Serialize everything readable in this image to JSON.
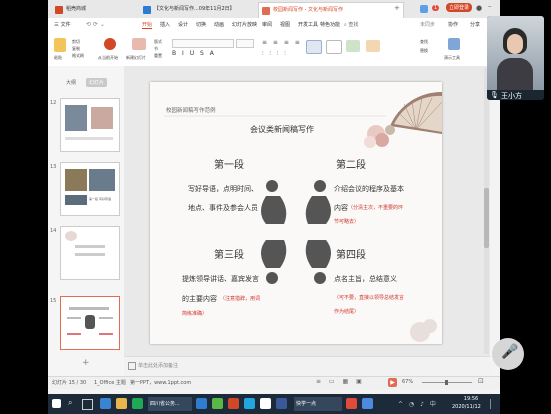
{
  "tabs": [
    {
      "label": "稻壳商城"
    },
    {
      "label": "【文化与新闻写作...09年11月2日】"
    },
    {
      "label": "校园新闻写作 - 文化与新闻写作"
    }
  ],
  "window_controls": {
    "badge": "1",
    "login": "立即登录"
  },
  "menu": {
    "file": "三 文件",
    "items": [
      "开始",
      "插入",
      "设计",
      "切换",
      "动画",
      "幻灯片放映",
      "审阅",
      "视图",
      "开发工具",
      "特色功能"
    ],
    "search": "查找",
    "right": [
      "未同步",
      "协作",
      "分享"
    ]
  },
  "ribbon": {
    "paste": "粘贴",
    "cut": "剪切",
    "copy": "复制",
    "format": "格式刷",
    "from_current": "从当前开始",
    "new_slide": "新建幻灯片",
    "layout": "版式",
    "section": "节",
    "reset": "重置",
    "find": "查找",
    "replace": "替换",
    "tools": "演示工具"
  },
  "left_panel": {
    "tab_outline": "大纲",
    "tab_slides": "幻灯片",
    "slides": [
      {
        "num": "12",
        "caption": ""
      },
      {
        "num": "13",
        "caption": "第一段 写好导语"
      },
      {
        "num": "14",
        "caption": ""
      },
      {
        "num": "15",
        "caption": ""
      }
    ]
  },
  "slide": {
    "header": "校园新闻稿写作范例",
    "title": "会议类新闻稿写作",
    "sections": [
      {
        "heading": "第一段",
        "lines": [
          "写好导语，点明时间、",
          "地点、事件及参会人员"
        ],
        "notes": []
      },
      {
        "heading": "第二段",
        "lines": [
          "介绍会议的程序及基本",
          "内容"
        ],
        "notes": [
          "（分清主次，不重要的环",
          "节可略去）"
        ]
      },
      {
        "heading": "第三段",
        "lines": [
          "提炼领导讲话、嘉宾发言",
          "的主要内容"
        ],
        "notes": [
          "（注意措辞，用词",
          "简练准确）"
        ]
      },
      {
        "heading": "第四段",
        "lines": [
          "点名主旨，总结意义"
        ],
        "notes": [
          "（可不要，直接以领导总结发言",
          "作为结尾）"
        ]
      }
    ]
  },
  "notes_placeholder": "单击此处添加备注",
  "status": {
    "slide_count": "幻灯片 15 / 30",
    "theme": "1_Office 主题",
    "watermark": "第一PPT，www.1ppt.com",
    "zoom": "67%"
  },
  "video": {
    "name": "王小方"
  },
  "taskbar": {
    "clock_time": "19:56",
    "clock_date": "2020/11/12",
    "items": [
      "四川省公务...",
      "快学一点"
    ]
  }
}
